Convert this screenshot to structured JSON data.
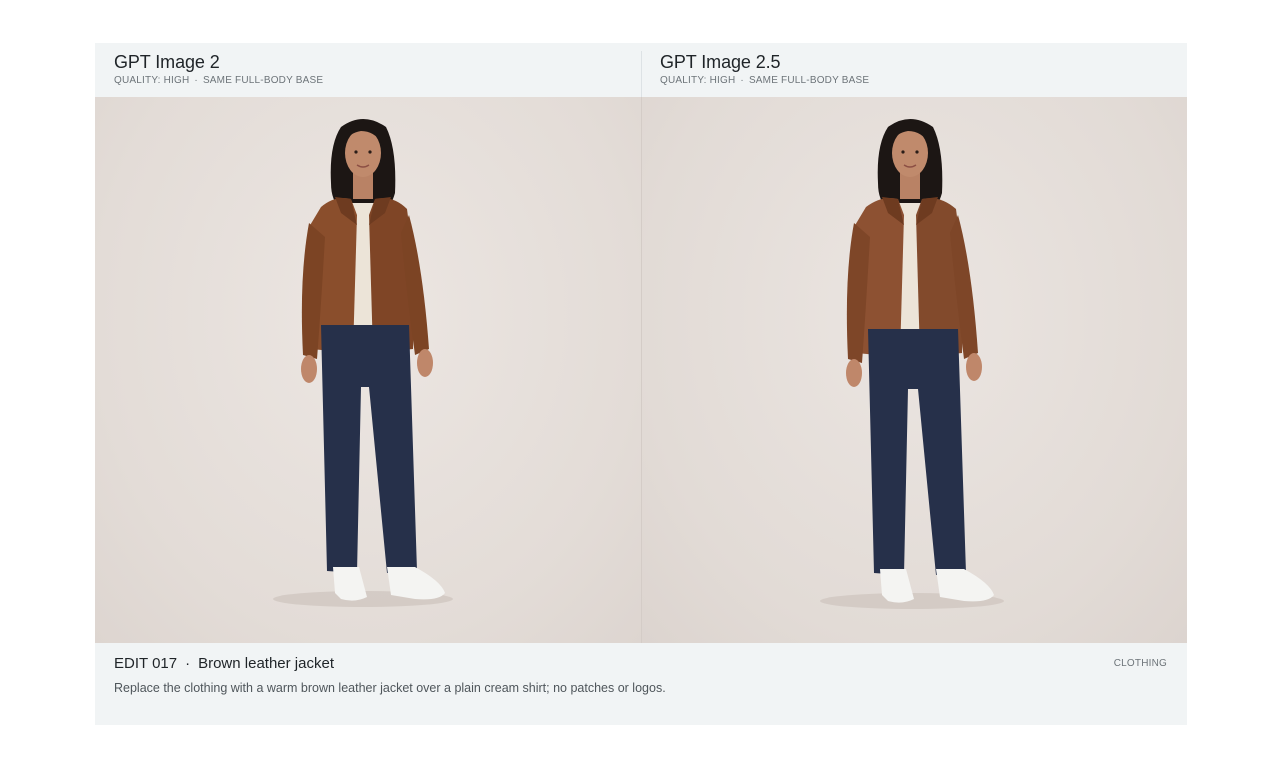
{
  "left": {
    "title": "GPT Image 2",
    "quality": "QUALITY: HIGH",
    "base": "SAME FULL-BODY BASE",
    "image": "full-body photo of a woman in a brown leather jacket, cream shirt, navy trousers and white sneakers"
  },
  "right": {
    "title": "GPT Image 2.5",
    "quality": "QUALITY: HIGH",
    "base": "SAME FULL-BODY BASE",
    "image": "full-body photo of a woman in a brown leather jacket, cream shirt, navy trousers and white sneakers"
  },
  "meta_sep": "·",
  "edit": {
    "id": "EDIT 017",
    "sep": "·",
    "name": "Brown leather jacket",
    "category": "CLOTHING",
    "description": "Replace the clothing with a warm brown leather jacket over a plain cream shirt; no patches or logos."
  },
  "colors": {
    "jacket": "#8a4e2c",
    "shirt": "#ece4d8",
    "trousers": "#26304a",
    "sneakers": "#f4f4f2",
    "hair": "#1c1614",
    "skin": "#c08a6c",
    "card_bg": "#f1f4f5"
  }
}
